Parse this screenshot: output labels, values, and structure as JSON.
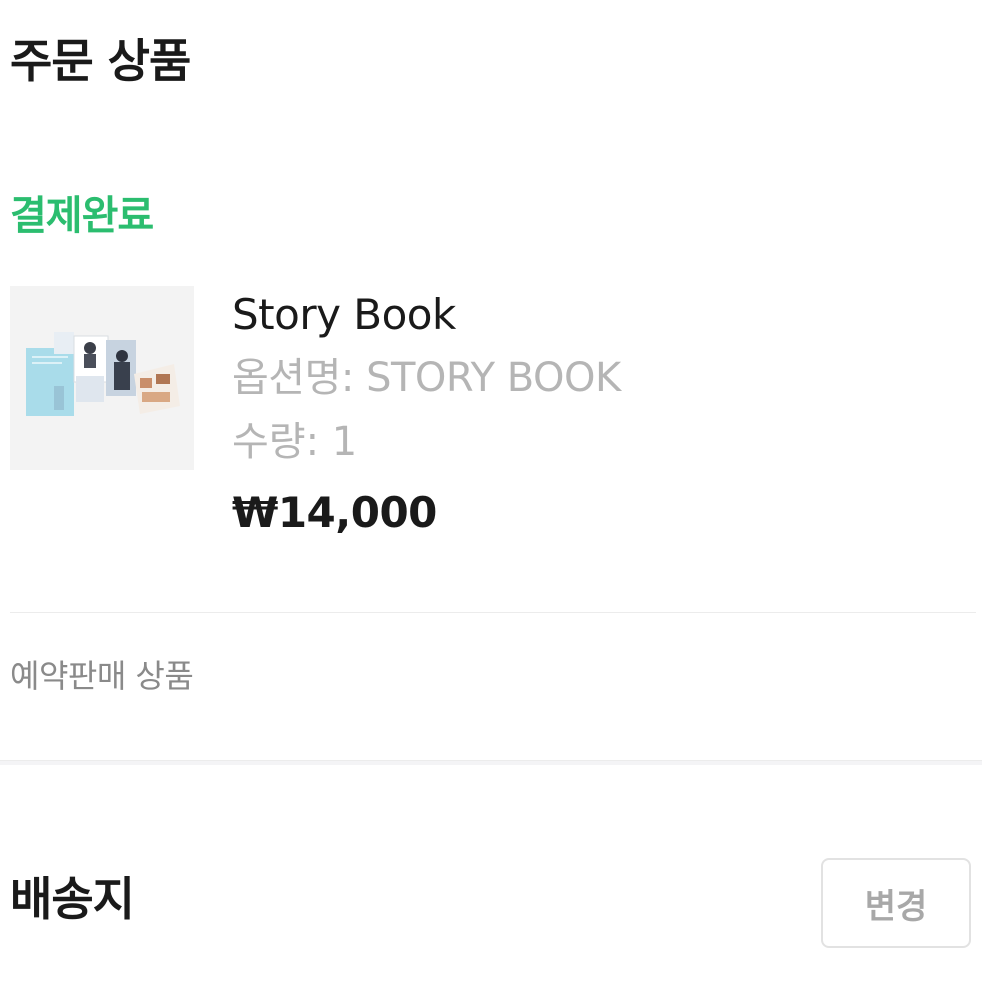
{
  "order_section": {
    "title": "주문 상품",
    "status": "결제완료",
    "status_color": "#2bbd6f"
  },
  "product": {
    "name": "Story Book",
    "option": "옵션명: STORY BOOK",
    "quantity": "수량: 1",
    "price": "₩14,000",
    "thumbnail_icon": "book-thumbnail-image"
  },
  "notice": {
    "preorder": "예약판매 상품"
  },
  "shipping_section": {
    "title": "배송지",
    "change_label": "변경"
  }
}
